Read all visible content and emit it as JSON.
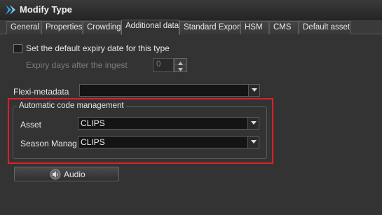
{
  "window": {
    "title": "Modify Type"
  },
  "tabs": [
    {
      "label": "General"
    },
    {
      "label": "Properties"
    },
    {
      "label": "Crowding"
    },
    {
      "label": "Additional data",
      "active": true
    },
    {
      "label": "Standard Export"
    },
    {
      "label": "HSM"
    },
    {
      "label": "CMS"
    },
    {
      "label": "Default asset"
    }
  ],
  "expiry": {
    "checkbox_label": "Set the default expiry date for this type",
    "checked": false,
    "days_label": "Expiry days after the ingest",
    "days_value": "0"
  },
  "flexi": {
    "label": "Flexi-metadata",
    "value": ""
  },
  "code_management": {
    "title": "Automatic code management",
    "asset_label": "Asset",
    "asset_value": "CLIPS",
    "season_label": "Season Manager",
    "season_value": "CLIPS"
  },
  "audio_button": {
    "label": "Audio",
    "icon": "speaker-icon"
  },
  "colors": {
    "highlight": "#e01e26",
    "background": "#333333",
    "combo_bg": "#141414"
  }
}
